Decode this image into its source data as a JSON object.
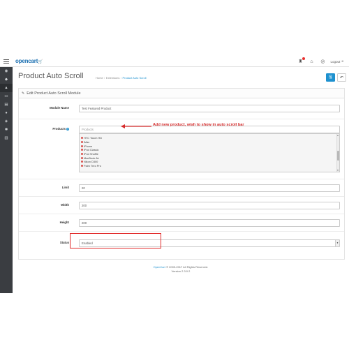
{
  "app": {
    "logo_text": "opencart",
    "logo_cart_glyph": "🛒",
    "accent_color": "#1e91cf"
  },
  "topbar": {
    "menu_icon": "menu-icon",
    "alerts_icon": "bell-icon",
    "home_icon": "home-icon",
    "help_icon": "life-ring-icon",
    "logout_label": "Logout"
  },
  "sidebar": {
    "items": [
      {
        "icon": "dashboard-icon",
        "glyph": "◉"
      },
      {
        "icon": "tag-icon",
        "glyph": "◆"
      },
      {
        "icon": "puzzle-icon",
        "glyph": "▲"
      },
      {
        "icon": "desktop-icon",
        "glyph": "▭"
      },
      {
        "icon": "cart-icon",
        "glyph": "▤"
      },
      {
        "icon": "user-icon",
        "glyph": "●"
      },
      {
        "icon": "share-icon",
        "glyph": "◈"
      },
      {
        "icon": "cog-icon",
        "glyph": "✱"
      },
      {
        "icon": "chart-icon",
        "glyph": "▥"
      }
    ]
  },
  "header": {
    "title": "Product Auto Scroll",
    "breadcrumb": [
      "Home",
      "Extensions",
      "Product Auto Scroll"
    ],
    "save_glyph": "🖫",
    "back_glyph": "↶"
  },
  "panel": {
    "heading": "Edit Product Auto Scroll Module",
    "pencil_glyph": "✎"
  },
  "form": {
    "module_name": {
      "label": "Module Name",
      "value": "Test Featured Product"
    },
    "products": {
      "label": "Products",
      "placeholder": "Products",
      "help_glyph": "?",
      "items": [
        "HTC Touch HD",
        "iMac",
        "iPhone",
        "iPod Classic",
        "iPod Shuffle",
        "MacBook Air",
        "Nikon D300",
        "Palm Treo Pro"
      ]
    },
    "limit": {
      "label": "Limit",
      "value": "20"
    },
    "width": {
      "label": "Width",
      "value": "200"
    },
    "height": {
      "label": "Height",
      "value": "200"
    },
    "status": {
      "label": "Status",
      "value": "Enabled"
    }
  },
  "annotation": {
    "text": "Add new product, wish to show in auto scroll bar",
    "color": "#d62b2b"
  },
  "footer": {
    "brand": "OpenCart",
    "copyright": "© 2009-2017 All Rights Reserved.",
    "version": "Version 2.3.0.2"
  }
}
